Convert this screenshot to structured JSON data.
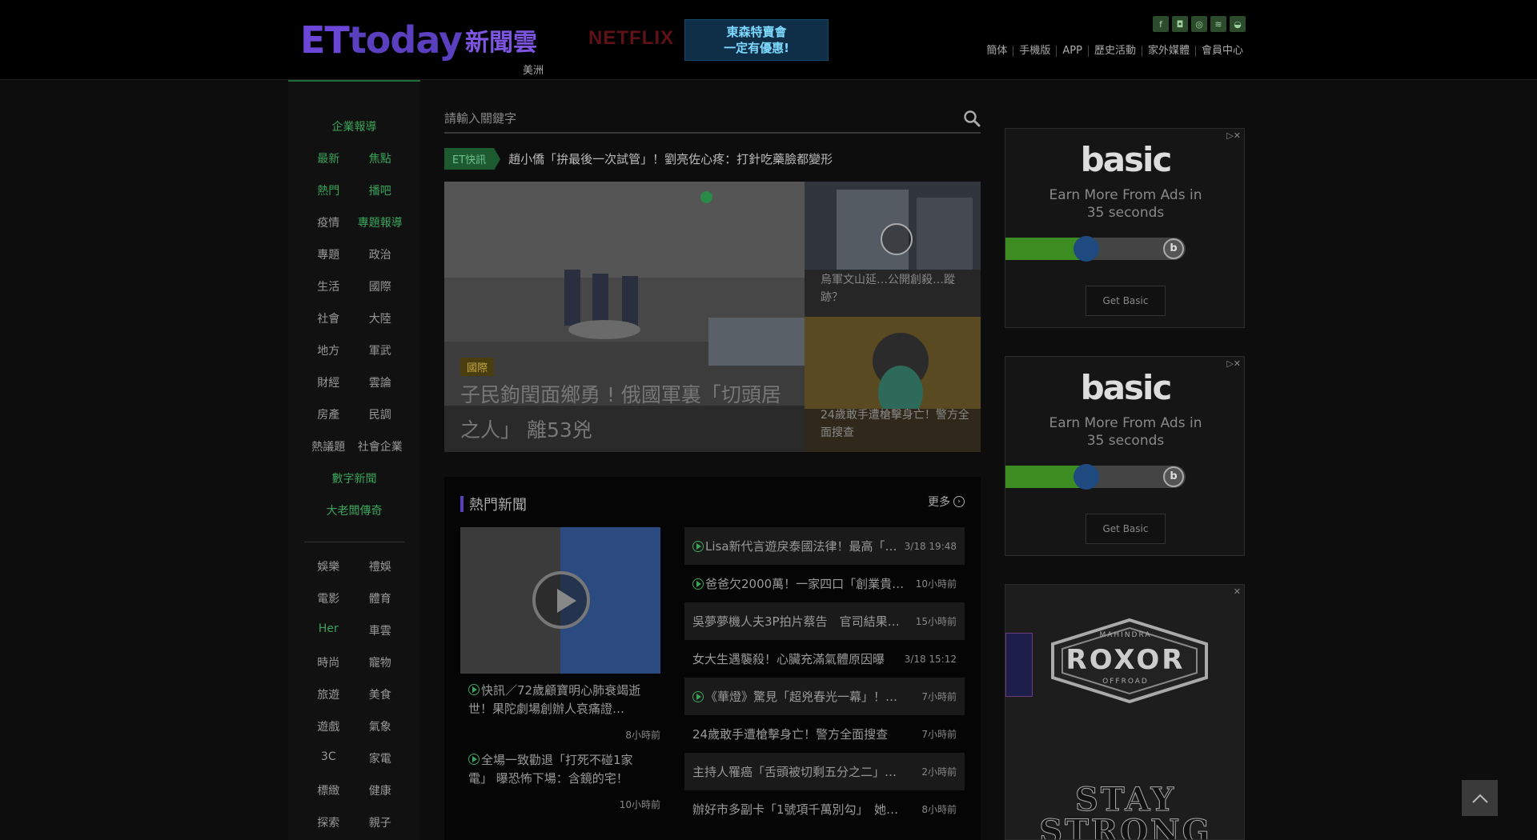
{
  "header": {
    "logo_et": "ET",
    "logo_today": "today",
    "logo_cn": "新聞雲",
    "region": "美洲",
    "netflix": "NETFLIX",
    "banner_line1": "東森特賣會",
    "banner_line2": "一定有優惠!",
    "topnav": [
      "簡体",
      "手機版",
      "APP",
      "歷史活動",
      "家外媒體",
      "會員中心"
    ]
  },
  "sidebar": {
    "top_single": "企業報導",
    "pairs": [
      [
        "最新",
        "焦點"
      ],
      [
        "熱門",
        "播吧"
      ],
      [
        "疫情",
        "專題報導"
      ],
      [
        "專題",
        "政治"
      ],
      [
        "生活",
        "國際"
      ],
      [
        "社會",
        "大陸"
      ],
      [
        "地方",
        "軍武"
      ],
      [
        "財經",
        "雲論"
      ],
      [
        "房產",
        "民調"
      ],
      [
        "熱議題",
        "社會企業"
      ]
    ],
    "single_1": "數字新聞",
    "single_2": "大老闆傳奇",
    "pairs2": [
      [
        "娛樂",
        "禮娛"
      ],
      [
        "電影",
        "體育"
      ],
      [
        "Her",
        "車雲"
      ],
      [
        "時尚",
        "寵物"
      ],
      [
        "旅遊",
        "美食"
      ],
      [
        "遊戲",
        "氣象"
      ],
      [
        "3C",
        "家電"
      ],
      [
        "標緻",
        "健康"
      ],
      [
        "探索",
        "親子"
      ]
    ]
  },
  "search": {
    "placeholder": "請輸入關鍵字"
  },
  "ticker": {
    "tag": "ET快訊",
    "text": "趙小僑「拚最後一次試管」！劉亮佐心疼：打針吃藥臉都變形"
  },
  "hero": {
    "category": "國際",
    "title": "子民鉤閏面鄉勇 ! 俄國軍裏「切頭居之人」 離53兇",
    "side1_caption": "烏軍文山延…公開創殺…蹤跡？",
    "side2_caption": "24歲敢手遭槍擊身亡！警方全面搜查"
  },
  "hot": {
    "title": "熱門新聞",
    "more": "更多",
    "featured1_title": "快訊／72歲顧寶明心肺衰竭逝世！果陀劇場創辦人哀痛證…",
    "featured1_time": "8小時前",
    "featured2_title": "全場一致勸退「打死不碰1家電」 曝恐怖下場：含鏡的宅！",
    "featured2_time": "10小時前",
    "list": [
      {
        "video": true,
        "title": "Lisa新代言遊戾泰國法律！最高「…",
        "time": "3/18 19:48"
      },
      {
        "video": true,
        "title": "爸爸欠2000萬！一家四口「創業貴…",
        "time": "10小時前"
      },
      {
        "video": false,
        "title": "吳夢夢機人夫3P拍片蔡告　官司結果…",
        "time": "15小時前"
      },
      {
        "video": false,
        "title": "女大生遇襲殺！心臟充滿氣體原因曝",
        "time": "3/18 15:12"
      },
      {
        "video": true,
        "title": "《華燈》驚見「超兇春光一幕」！…",
        "time": "7小時前"
      },
      {
        "video": false,
        "title": "24歲敢手遭槍擊身亡！警方全面搜查",
        "time": "7小時前"
      },
      {
        "video": false,
        "title": "主持人罹癌「舌頭被切剩五分之二」…",
        "time": "2小時前"
      },
      {
        "video": false,
        "title": "辦好市多副卡「1號項千萬別勾」　她…",
        "time": "8小時前"
      }
    ]
  },
  "ads": {
    "basic_brand": "basic",
    "basic_line1": "Earn More From Ads in",
    "basic_line2": "35 seconds",
    "basic_button": "Get Basic",
    "basic_progress": 0.45,
    "roxor_brand": "ROXOR",
    "roxor_top": "MAHINDRA",
    "roxor_bottom": "OFFROAD",
    "roxor_slogan1": "STAY",
    "roxor_slogan2": "STRONG"
  }
}
